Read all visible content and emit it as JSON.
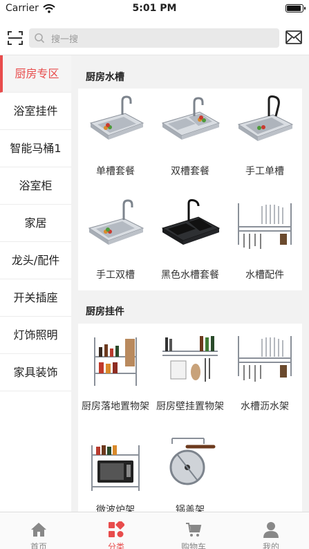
{
  "status_bar": {
    "carrier": "Carrier",
    "time": "5:01 PM"
  },
  "header": {
    "search_placeholder": "搜一搜"
  },
  "sidebar": {
    "items": [
      {
        "label": "厨房专区",
        "active": true
      },
      {
        "label": "浴室挂件"
      },
      {
        "label": "智能马桶1"
      },
      {
        "label": "浴室柜"
      },
      {
        "label": "家居"
      },
      {
        "label": "龙头/配件"
      },
      {
        "label": "开关插座"
      },
      {
        "label": "灯饰照明"
      },
      {
        "label": "家具装饰"
      }
    ]
  },
  "sections": [
    {
      "title": "厨房水槽",
      "items": [
        {
          "label": "单槽套餐",
          "icon": "single-sink-icon"
        },
        {
          "label": "双槽套餐",
          "icon": "double-sink-icon"
        },
        {
          "label": "手工单槽",
          "icon": "handmade-single-sink-icon"
        },
        {
          "label": "手工双槽",
          "icon": "handmade-double-sink-icon"
        },
        {
          "label": "黑色水槽套餐",
          "icon": "black-sink-icon"
        },
        {
          "label": "水槽配件",
          "icon": "sink-rack-icon"
        }
      ]
    },
    {
      "title": "厨房挂件",
      "items": [
        {
          "label": "厨房落地置物架",
          "icon": "floor-shelf-icon"
        },
        {
          "label": "厨房壁挂置物架",
          "icon": "wall-shelf-icon"
        },
        {
          "label": "水槽沥水架",
          "icon": "drain-rack-icon"
        },
        {
          "label": "微波炉架",
          "icon": "microwave-rack-icon"
        },
        {
          "label": "锅盖架",
          "icon": "lid-rack-icon"
        }
      ]
    }
  ],
  "tabbar": {
    "tabs": [
      {
        "label": "首页",
        "icon": "home-icon"
      },
      {
        "label": "分类",
        "icon": "category-icon",
        "active": true
      },
      {
        "label": "购物车",
        "icon": "cart-icon"
      },
      {
        "label": "我的",
        "icon": "user-icon"
      }
    ]
  },
  "colors": {
    "accent": "#e84c4c",
    "inactive": "#888888",
    "background": "#f2f2f2"
  }
}
